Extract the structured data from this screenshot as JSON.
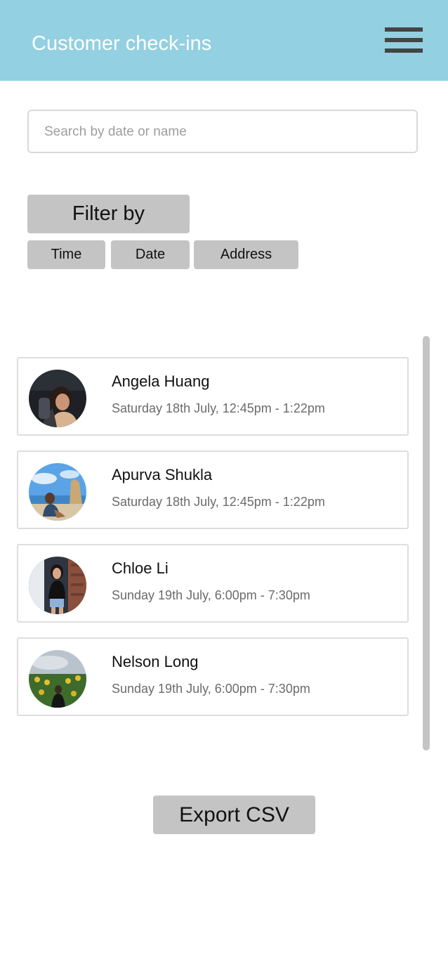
{
  "header": {
    "title": "Customer check-ins",
    "menu_icon": "hamburger-menu-icon",
    "background_color": "#93d0e1"
  },
  "search": {
    "placeholder": "Search by date or name",
    "value": ""
  },
  "filter": {
    "label": "Filter by",
    "options": [
      "Time",
      "Date",
      "Address"
    ]
  },
  "checkins": [
    {
      "name": "Angela Huang",
      "time": "Saturday 18th July, 12:45pm - 1:22pm",
      "avatar": "avatar-photo"
    },
    {
      "name": "Apurva Shukla",
      "time": "Saturday 18th July, 12:45pm - 1:22pm",
      "avatar": "avatar-photo"
    },
    {
      "name": "Chloe Li",
      "time": "Sunday 19th July, 6:00pm - 7:30pm",
      "avatar": "avatar-photo"
    },
    {
      "name": "Nelson Long",
      "time": "Sunday 19th July, 6:00pm - 7:30pm",
      "avatar": "avatar-photo"
    }
  ],
  "export": {
    "label": "Export CSV"
  }
}
